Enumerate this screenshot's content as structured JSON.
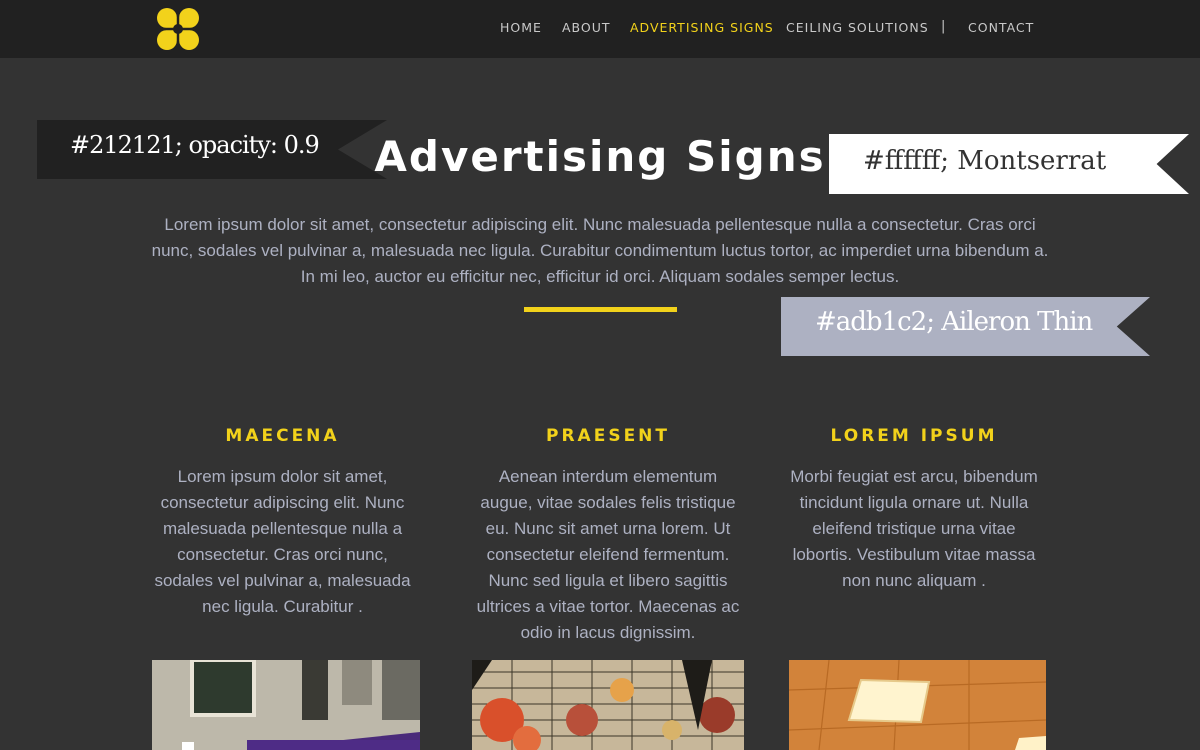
{
  "nav": {
    "items": [
      {
        "label": "HOME",
        "active": false
      },
      {
        "label": "ABOUT",
        "active": false
      },
      {
        "label": "ADVERTISING SIGNS",
        "active": true
      },
      {
        "label": "CEILING SOLUTIONS",
        "active": false
      },
      {
        "label": "CONTACT",
        "active": false
      }
    ],
    "separator": "|"
  },
  "hero": {
    "title": "Advertising Signs",
    "text": "Lorem ipsum dolor sit amet, consectetur adipiscing elit. Nunc malesuada pellentesque nulla a consectetur. Cras orci nunc, sodales vel pulvinar a, malesuada nec ligula. Curabitur condimentum luctus tortor, ac imperdiet urna bibendum a. In mi leo, auctor eu efficitur nec, efficitur id orci. Aliquam sodales semper lectus."
  },
  "annotations": [
    "#212121; opacity: 0.9",
    "#ffffff; Montserrat",
    "#adb1c2; Aileron Thin"
  ],
  "columns": [
    {
      "title": "MAECENA",
      "text": "Lorem ipsum dolor sit amet, consectetur adipiscing elit. Nunc malesuada pellentesque nulla a consectetur. Cras orci nunc, sodales vel pulvinar a, malesuada nec ligula. Curabitur ."
    },
    {
      "title": "PRAESENT",
      "text": "Aenean interdum elementum augue, vitae sodales felis tristique eu. Nunc sit amet urna lorem. Ut consectetur eleifend fermentum. Nunc sed ligula et libero sagittis ultrices a vitae tortor. Maecenas ac odio in lacus dignissim."
    },
    {
      "title": "LOREM IPSUM",
      "text": "Morbi feugiat est arcu, bibendum tincidunt ligula ornare ut. Nulla eleifend tristique urna vitae lobortis. Vestibulum vitae massa non nunc aliquam ."
    }
  ],
  "colors": {
    "nav_bg": "#212121",
    "page_bg": "#333333",
    "accent": "#f2d21b",
    "body_text": "#adb1c2",
    "title_text": "#ffffff"
  },
  "icons": {
    "logo": "yellow-four-lobe-logo"
  }
}
